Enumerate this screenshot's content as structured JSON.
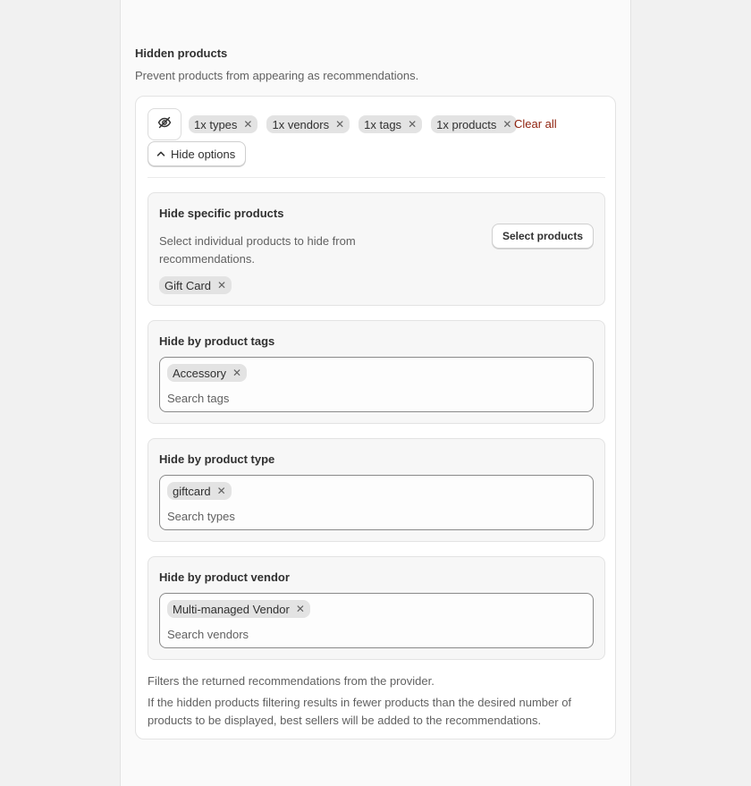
{
  "section": {
    "title": "Hidden products",
    "description": "Prevent products from appearing as recommendations."
  },
  "filters": {
    "toggle_icon": "eye-off-icon",
    "chips": [
      {
        "label": "1x types"
      },
      {
        "label": "1x vendors"
      },
      {
        "label": "1x tags"
      },
      {
        "label": "1x products"
      }
    ],
    "clear_all_label": "Clear all",
    "hide_options_label": "Hide options",
    "hide_options_icon": "chevron-up-icon",
    "clear_all_color": "#8e1f0b"
  },
  "specific_products": {
    "title": "Hide specific products",
    "description": "Select individual products to hide from recommendations.",
    "button_label": "Select products",
    "selected": [
      "Gift Card"
    ]
  },
  "tags": {
    "title": "Hide by product tags",
    "selected": [
      "Accessory"
    ],
    "placeholder": "Search tags"
  },
  "types": {
    "title": "Hide by product type",
    "selected": [
      "giftcard"
    ],
    "placeholder": "Search types"
  },
  "vendors": {
    "title": "Hide by product vendor",
    "selected": [
      "Multi-managed Vendor"
    ],
    "placeholder": "Search vendors"
  },
  "footer": {
    "line1": "Filters the returned recommendations from the provider.",
    "line2": "If the hidden products filtering results in fewer products than the desired number of products to be displayed, best sellers will be added to the recommendations."
  }
}
